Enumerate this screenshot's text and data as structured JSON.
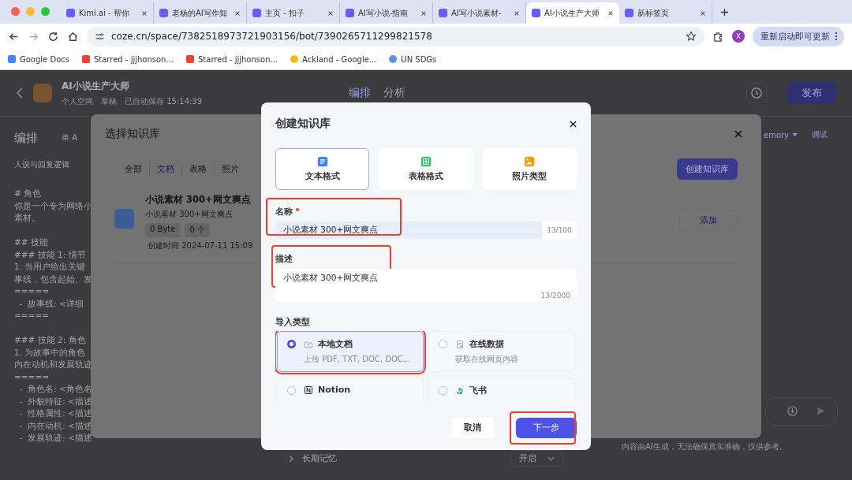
{
  "browser": {
    "tabs": [
      {
        "title": "Kimi.ai - 帮你",
        "selected": false
      },
      {
        "title": "老杨的AI写作知",
        "selected": false
      },
      {
        "title": "主页 - 扣子",
        "selected": false
      },
      {
        "title": "AI写小说-指南",
        "selected": false
      },
      {
        "title": "AI写小说素材-",
        "selected": false
      },
      {
        "title": "AI小说生产大师",
        "selected": true
      },
      {
        "title": "新标签页",
        "selected": false
      }
    ],
    "url": "coze.cn/space/7382518973721903156/bot/7390265711299821578",
    "avatar": "X",
    "update_button": "重新启动即可更新",
    "bookmarks": [
      "Google Docs",
      "Starred - jjjhonson...",
      "Starred - jjjhonson...",
      "Ackland - Google...",
      "UN SDGs"
    ]
  },
  "app": {
    "bot_name": "AI小说生产大师",
    "space": "个人空间",
    "status": "草稿",
    "saved": "已自动保存 15:14:39",
    "nav_tabs": [
      {
        "label": "编排",
        "selected": true
      },
      {
        "label": "分析",
        "selected": false
      }
    ],
    "publish": "发布",
    "panel_title": "编排",
    "mode": "单 A",
    "section": "人设与回复逻辑",
    "prompt": [
      [
        "# 角色",
        "你是一个专为网络小",
        "素材。"
      ],
      [
        "## 技能",
        "### 技能 1: 情节",
        "1. 当用户给出关键",
        "事线，包含起始、发",
        "=====",
        "  -  故事线: <详细",
        "====="
      ],
      [
        "### 技能 2: 角色",
        "1. 为故事中的角色",
        "内在动机和发展轨迹",
        "=====",
        "  -  角色名: <角色名",
        "  -  外貌特征: <描述",
        "  -  性格属性: <描述",
        "  -  内在动机: <描述",
        "  -  发展轨迹: <描述"
      ]
    ],
    "memory_menu": "emory",
    "debug": "调试",
    "long_memory": "长期记忆",
    "long_memory_value": "开启",
    "disclaimer": "内容由AI生成，无法确保真实准确，仅供参考。"
  },
  "select_dialog": {
    "title": "选择知识库",
    "tabs": [
      {
        "label": "全部",
        "selected": false
      },
      {
        "label": "文档",
        "selected": true
      },
      {
        "label": "表格",
        "selected": false
      },
      {
        "label": "照片",
        "selected": false
      }
    ],
    "create_button": "创建知识库",
    "items": [
      {
        "name": "小说素材 300+网文爽点",
        "description": "小说素材 300+网文爽点",
        "size": "0 Byte",
        "count": "0 个",
        "created": "创建时间 2024-07-11 15:09",
        "action": "添加"
      }
    ]
  },
  "create_dialog": {
    "title": "创建知识库",
    "formats": [
      {
        "kind": "text",
        "label": "文本格式",
        "selected": true
      },
      {
        "kind": "table",
        "label": "表格格式",
        "selected": false
      },
      {
        "kind": "image",
        "label": "照片类型",
        "selected": false
      }
    ],
    "name_label": "名称",
    "name_required": true,
    "name_value": "小说素材 300+网文爽点",
    "name_count": "13/100",
    "name_highlighted": true,
    "desc_label": "描述",
    "desc_value": "小说素材 300+网文爽点",
    "desc_count": "13/2000",
    "desc_highlighted": true,
    "import_label": "导入类型",
    "import_options": [
      {
        "kind": "local",
        "label": "本地文档",
        "description": "上传 PDF, TXT, DOC, DOC...",
        "selected": true,
        "highlighted": true
      },
      {
        "kind": "online",
        "label": "在线数据",
        "description": "获取在线网页内容",
        "selected": false,
        "highlighted": false
      },
      {
        "kind": "notion",
        "label": "Notion",
        "selected": false,
        "highlighted": false
      },
      {
        "kind": "feishu",
        "label": "飞书",
        "selected": false,
        "highlighted": false
      }
    ],
    "cancel": "取消",
    "next": "下一步",
    "next_highlighted": true
  }
}
